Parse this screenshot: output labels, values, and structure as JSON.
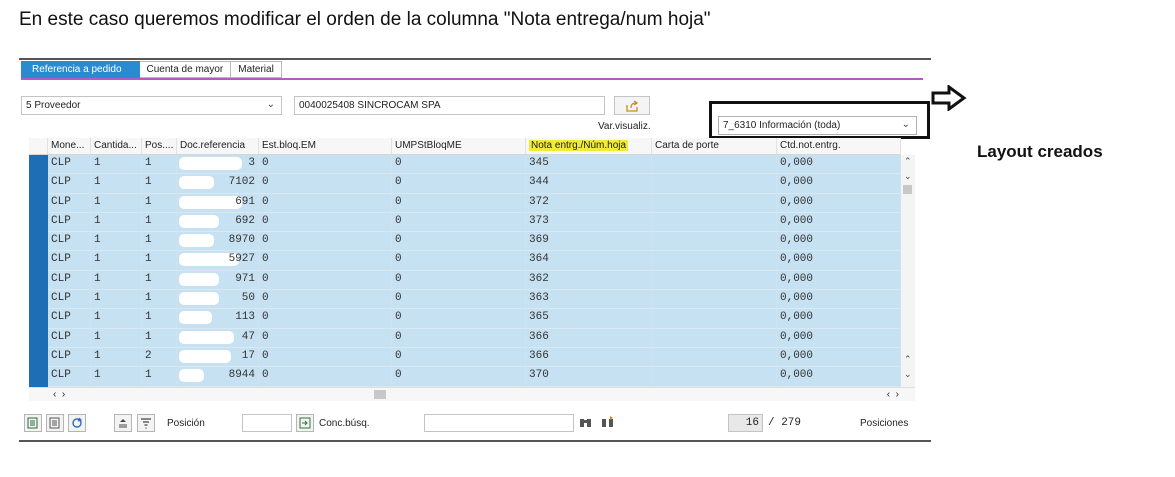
{
  "instruction": "En este caso queremos modificar el orden de la columna \"Nota entrega/num hoja\"",
  "tabs": [
    {
      "label": "Referencia a pedido",
      "active": true
    },
    {
      "label": "Cuenta de mayor",
      "active": false
    },
    {
      "label": "Material",
      "active": false
    }
  ],
  "filter": {
    "selected": "5 Proveedor",
    "vendor": "0040025408 SINCROCAM SPA"
  },
  "variant": {
    "label": "Var.visualiz.",
    "selected": "7_6310 Información (toda)"
  },
  "callout": {
    "caption": "Layout creados"
  },
  "grid": {
    "headers": [
      "Mone...",
      "Cantida...",
      "Pos....",
      "Doc.referencia",
      "Est.bloq.EM",
      "UMPStBloqME",
      "Nota entrg./Núm.hoja",
      "Carta de porte",
      "Ctd.not.entrg."
    ],
    "rows": [
      {
        "cur": "CLP",
        "qty": "1",
        "pos": "1",
        "ref": "3",
        "est": "0",
        "ump": "0",
        "nota": "345",
        "ctd": "0,000"
      },
      {
        "cur": "CLP",
        "qty": "1",
        "pos": "1",
        "ref": "7102",
        "est": "0",
        "ump": "0",
        "nota": "344",
        "ctd": "0,000"
      },
      {
        "cur": "CLP",
        "qty": "1",
        "pos": "1",
        "ref": "691",
        "est": "0",
        "ump": "0",
        "nota": "372",
        "ctd": "0,000"
      },
      {
        "cur": "CLP",
        "qty": "1",
        "pos": "1",
        "ref": "692",
        "est": "0",
        "ump": "0",
        "nota": "373",
        "ctd": "0,000"
      },
      {
        "cur": "CLP",
        "qty": "1",
        "pos": "1",
        "ref": "8970",
        "est": "0",
        "ump": "0",
        "nota": "369",
        "ctd": "0,000"
      },
      {
        "cur": "CLP",
        "qty": "1",
        "pos": "1",
        "ref": "5927",
        "est": "0",
        "ump": "0",
        "nota": "364",
        "ctd": "0,000"
      },
      {
        "cur": "CLP",
        "qty": "1",
        "pos": "1",
        "ref": "971",
        "est": "0",
        "ump": "0",
        "nota": "362",
        "ctd": "0,000"
      },
      {
        "cur": "CLP",
        "qty": "1",
        "pos": "1",
        "ref": "50",
        "est": "0",
        "ump": "0",
        "nota": "363",
        "ctd": "0,000"
      },
      {
        "cur": "CLP",
        "qty": "1",
        "pos": "1",
        "ref": "113",
        "est": "0",
        "ump": "0",
        "nota": "365",
        "ctd": "0,000"
      },
      {
        "cur": "CLP",
        "qty": "1",
        "pos": "1",
        "ref": "47",
        "est": "0",
        "ump": "0",
        "nota": "366",
        "ctd": "0,000"
      },
      {
        "cur": "CLP",
        "qty": "1",
        "pos": "2",
        "ref": "17",
        "est": "0",
        "ump": "0",
        "nota": "366",
        "ctd": "0,000"
      },
      {
        "cur": "CLP",
        "qty": "1",
        "pos": "1",
        "ref": "8944",
        "est": "0",
        "ump": "0",
        "nota": "370",
        "ctd": "0,000"
      }
    ]
  },
  "toolbar": {
    "position_label": "Posición",
    "search_label": "Conc.búsq.",
    "current": "16",
    "total": "/ 279",
    "items_label": "Posiciones"
  },
  "colors": {
    "accent": "#2b8bd0",
    "row_bg": "#c6e1f1",
    "highlight": "#f2ea39",
    "tab_line": "#b25cc0"
  }
}
